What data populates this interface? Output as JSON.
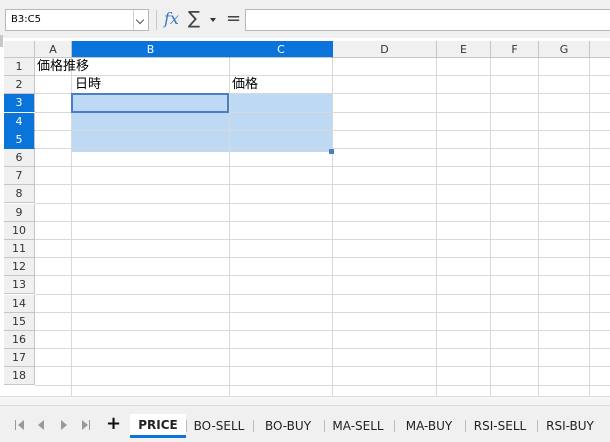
{
  "name_box": {
    "value": "B3:C5"
  },
  "formula_bar": {
    "fx_label": "fx",
    "sum_label": "∑",
    "equals_label": "=",
    "content": ""
  },
  "columns": [
    "A",
    "B",
    "C",
    "D",
    "E",
    "F",
    "G"
  ],
  "selected_columns": [
    "B",
    "C"
  ],
  "rows": [
    "1",
    "2",
    "3",
    "4",
    "5",
    "6",
    "7",
    "8",
    "9",
    "10",
    "11",
    "12",
    "13",
    "14",
    "15",
    "16",
    "17",
    "18"
  ],
  "selected_rows": [
    "3",
    "4",
    "5"
  ],
  "selection_range": "B3:C5",
  "cells": {
    "A1": "価格推移",
    "B2": "日時",
    "C2": "価格"
  },
  "sheet_tabs": [
    "PRICE",
    "BO-SELL",
    "BO-BUY",
    "MA-SELL",
    "MA-BUY",
    "RSI-SELL",
    "RSI-BUY"
  ],
  "active_tab": "PRICE",
  "add_sheet_label": "+",
  "colors": {
    "selection_header": "#0a74da",
    "selection_fill": "#bdd9f3",
    "active_border": "#4a7fc7"
  }
}
